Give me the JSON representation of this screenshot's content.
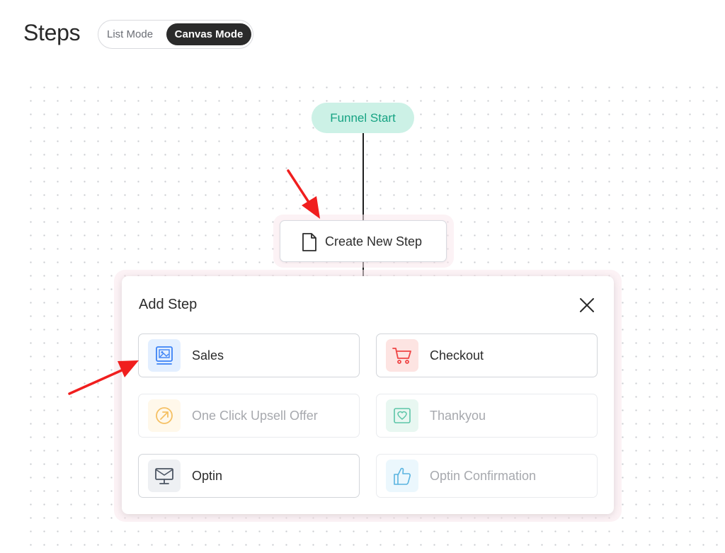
{
  "page": {
    "title": "Steps"
  },
  "mode_toggle": {
    "list_label": "List Mode",
    "canvas_label": "Canvas Mode",
    "selected": "Canvas Mode"
  },
  "canvas": {
    "start_node": "Funnel Start",
    "create_step_label": "Create New Step"
  },
  "add_step_panel": {
    "title": "Add Step",
    "options": [
      {
        "label": "Sales",
        "icon": "sales-page-icon",
        "enabled": true,
        "color": "#3b82f6"
      },
      {
        "label": "Checkout",
        "icon": "cart-icon",
        "enabled": true,
        "color": "#ef4444"
      },
      {
        "label": "One Click Upsell Offer",
        "icon": "upsell-arrow-icon",
        "enabled": false,
        "color": "#f5c063"
      },
      {
        "label": "Thankyou",
        "icon": "heart-icon",
        "enabled": false,
        "color": "#5cc5a8"
      },
      {
        "label": "Optin",
        "icon": "optin-envelope-icon",
        "enabled": true,
        "color": "#4b5563"
      },
      {
        "label": "Optin Confirmation",
        "icon": "thumbs-up-icon",
        "enabled": false,
        "color": "#5ab4e0"
      }
    ]
  },
  "colors": {
    "accent_green": "#16a383",
    "funnel_start_bg": "#ccf1e6",
    "dark_toggle": "#2b2b2b",
    "annotation_red": "#f01e1e"
  }
}
